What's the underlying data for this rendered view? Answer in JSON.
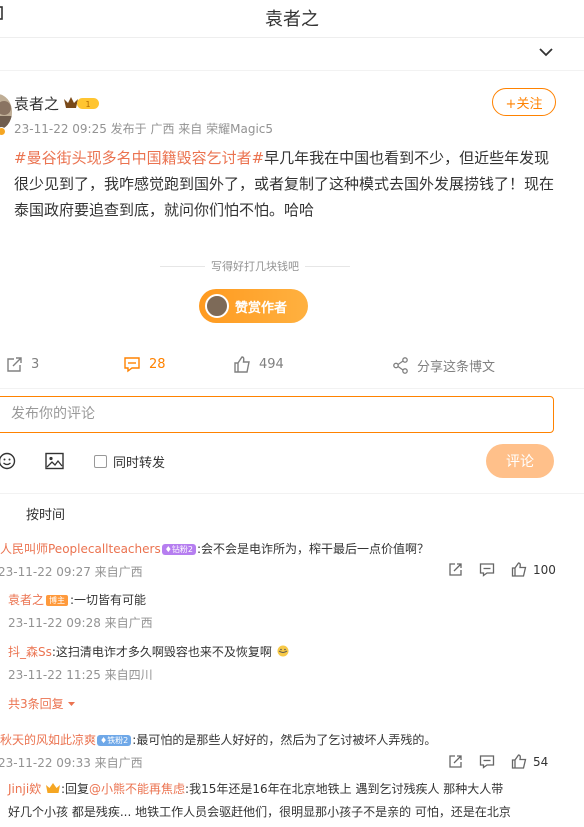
{
  "header": {
    "back_glyph": "☐",
    "title": "袁者之"
  },
  "post": {
    "username": "袁者之",
    "follow_label": "+关注",
    "meta": "23-11-22 09:25  发布于 广西  来自 荣耀Magic5",
    "hashtag": "#曼谷街头现多名中国籍毁容乞讨者#",
    "body": "早几年我在中国也看到不少，但近些年发现很少见到了，我咋感觉跑到国外了，或者复制了这种模式去国外发展捞钱了！现在泰国政府要追查到底，就问你们怕不怕。哈哈"
  },
  "reward": {
    "prompt": "写得好打几块钱吧",
    "button_label": "赞赏作者"
  },
  "actions": {
    "repost_count": "3",
    "comment_count": "28",
    "like_count": "494",
    "share_label": "分享这条博文"
  },
  "composer": {
    "placeholder": "发布你的评论",
    "repost_label": "同时转发",
    "submit_label": "评论"
  },
  "comments": {
    "sort_label": "按时间",
    "items": [
      {
        "name": "人民叫师Peoplecallteachers",
        "badge": "钻粉2",
        "text": ":会不会是电诈所为，榨干最后一点价值啊？",
        "meta": "23-11-22 09:27 来自广西",
        "likes": "100"
      },
      {
        "name": "袁者之",
        "badge": "博主",
        "text": ":一切皆有可能",
        "meta": "23-11-22 09:28 来自广西"
      },
      {
        "name": "抖_森Ss",
        "text": ":这扫清电诈才多久啊毁容也来不及恢复啊",
        "meta": "23-11-22 11:25 来自四川"
      },
      {
        "more_label": "共3条回复"
      },
      {
        "name": "秋天的风如此凉爽",
        "badge": "铁粉2",
        "text": ":最可怕的是那些人好好的，然后为了乞讨被坏人弄残的。",
        "meta": "23-11-22 09:33 来自广西",
        "likes": "54"
      },
      {
        "name": "Jinji欸",
        "reply_prefix": ":回复",
        "mention": "@小熊不能再焦虑",
        "text": ":我15年还是16年在北京地铁上 遇到乞讨残疾人 那种大人带",
        "text2": "好几个小孩 都是残疾... 地铁工作人员会驱赶他们，很明显那小孩子不是亲的 可怕，还是在北京"
      }
    ]
  },
  "colors": {
    "accent": "#ff8200",
    "link": "#eb7350",
    "meta_gray": "#939393"
  }
}
